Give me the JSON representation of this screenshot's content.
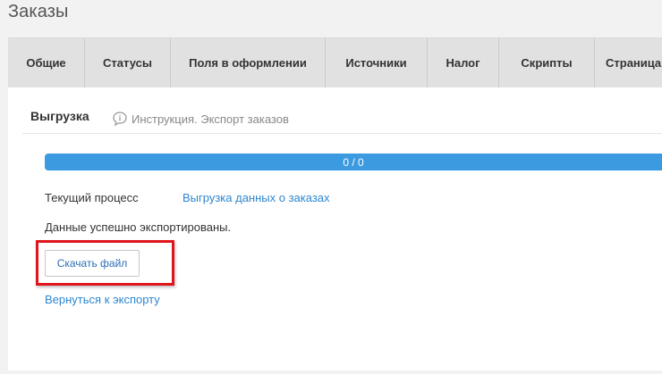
{
  "page": {
    "title": "Заказы"
  },
  "tabs": [
    {
      "label": "Общие"
    },
    {
      "label": "Статусы"
    },
    {
      "label": "Поля в оформлении"
    },
    {
      "label": "Источники"
    },
    {
      "label": "Налог"
    },
    {
      "label": "Скрипты"
    },
    {
      "label": "Страница"
    }
  ],
  "export": {
    "title": "Выгрузка",
    "instruction_link": "Инструкция. Экспорт заказов",
    "progress": {
      "text": "0 / 0",
      "done": 0,
      "total": 0
    },
    "current_process_label": "Текущий процесс",
    "current_process_value": "Выгрузка данных о заказах",
    "success_message": "Данные успешно экспортированы.",
    "download_button": "Скачать файл",
    "back_link": "Вернуться к экспорту"
  },
  "colors": {
    "progress_bar": "#3c9be0",
    "link": "#2e86d1",
    "highlight": "#e0141b"
  },
  "icons": {
    "instruction": "speech-bubble-info-icon"
  }
}
